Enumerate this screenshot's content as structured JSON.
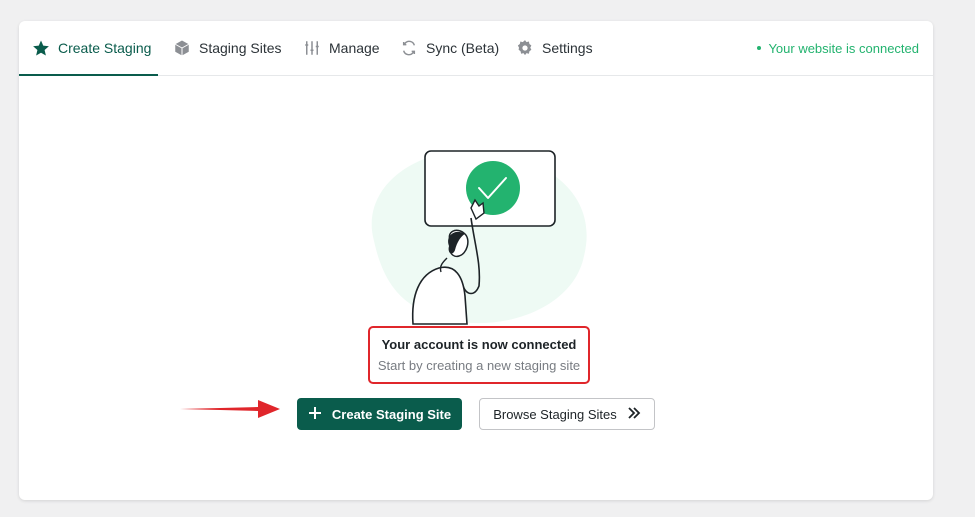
{
  "tabs": {
    "create_staging": "Create Staging",
    "staging_sites": "Staging Sites",
    "manage": "Manage",
    "sync": "Sync (Beta)",
    "settings": "Settings"
  },
  "status": {
    "text": "Your website is connected",
    "color": "#23b36f"
  },
  "message": {
    "title": "Your account is now connected",
    "subtitle": "Start by creating a new staging site"
  },
  "buttons": {
    "create_label": "Create Staging Site",
    "browse_label": "Browse Staging Sites"
  },
  "colors": {
    "accent": "#0a5c4c",
    "highlight": "#e0262b"
  },
  "icons": [
    "star-icon",
    "cube-icon",
    "sliders-icon",
    "sync-icon",
    "gear-icon",
    "check-icon",
    "plus-icon",
    "double-chevron-right-icon"
  ]
}
